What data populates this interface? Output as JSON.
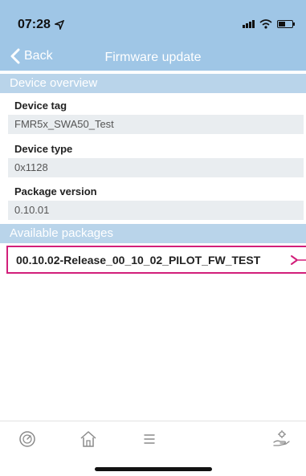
{
  "status_bar": {
    "time": "07:28",
    "location_icon": "location-arrow-icon",
    "signal_icon": "cell-signal-icon",
    "wifi_icon": "wifi-icon",
    "battery_icon": "battery-icon"
  },
  "navbar": {
    "back_label": "Back",
    "title": "Firmware update"
  },
  "device_overview": {
    "header": "Device overview",
    "fields": [
      {
        "label": "Device tag",
        "value": "FMR5x_SWA50_Test"
      },
      {
        "label": "Device type",
        "value": "0x1128"
      },
      {
        "label": "Package version",
        "value": "0.10.01"
      }
    ]
  },
  "available_packages": {
    "header": "Available packages",
    "items": [
      {
        "label": "00.10.02-Release_00_10_02_PILOT_FW_TEST"
      }
    ]
  },
  "tabbar": {
    "items": [
      "gauge-icon",
      "home-icon",
      "menu-icon",
      "hand-settings-icon"
    ]
  },
  "colors": {
    "header_blue": "#9fc6e6",
    "section_blue": "#b9d4ea",
    "field_bg": "#e9edf0",
    "highlight": "#d21f7a"
  }
}
